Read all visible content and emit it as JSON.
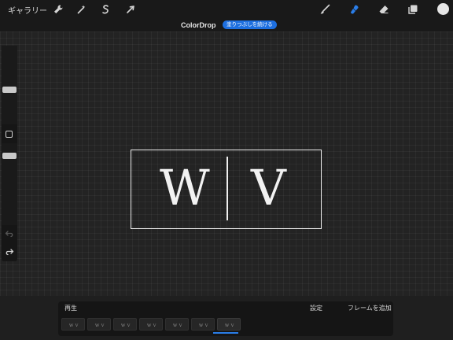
{
  "top_bar": {
    "gallery_label": "ギャラリー",
    "left_tools": [
      {
        "name": "actions-wrench-icon"
      },
      {
        "name": "adjustments-wand-icon"
      },
      {
        "name": "selection-s-icon"
      },
      {
        "name": "transform-arrow-icon"
      }
    ],
    "right_tools": [
      {
        "name": "brush-icon",
        "active": false
      },
      {
        "name": "smudge-icon",
        "active": true
      },
      {
        "name": "eraser-icon",
        "active": false
      },
      {
        "name": "layers-icon",
        "active": false
      },
      {
        "name": "color-swatch-icon",
        "active": false
      }
    ],
    "active_color": "#2a7de8",
    "swatch_color": "#e6e6e6"
  },
  "document": {
    "title": "ColorDrop",
    "badge": "塗りつぶしを続ける"
  },
  "sidebar": {
    "size_slider_level": 0.33,
    "opacity_slider_level": 0.5,
    "modify_label": "",
    "undo_icon": "undo-icon",
    "redo_icon": "redo-icon"
  },
  "artwork": {
    "left_letter": "W",
    "right_letter": "V"
  },
  "timeline": {
    "play_label": "再生",
    "settings_label": "設定",
    "add_frame_label": "フレームを追加",
    "frames": [
      {
        "thumb": "W V"
      },
      {
        "thumb": "W V"
      },
      {
        "thumb": "W V"
      },
      {
        "thumb": "W V"
      },
      {
        "thumb": "W V"
      },
      {
        "thumb": "W V"
      },
      {
        "thumb": "W V"
      }
    ],
    "active_frame_index": 6
  }
}
